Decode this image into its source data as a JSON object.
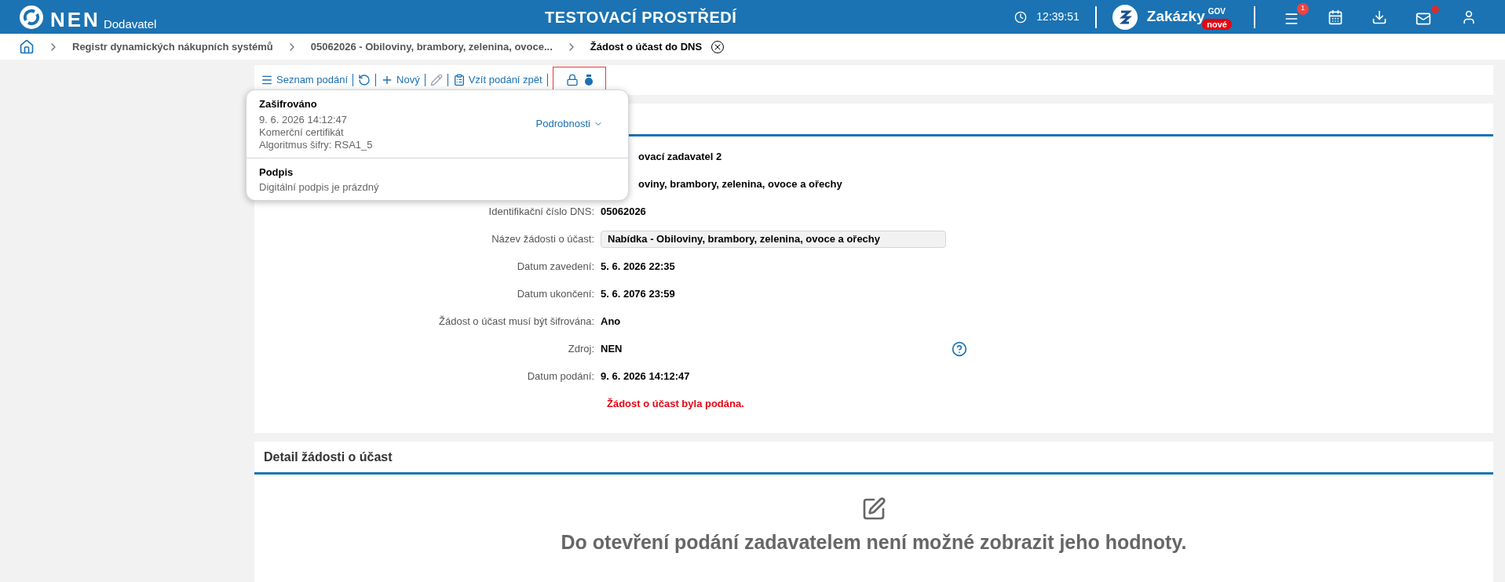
{
  "header": {
    "logo": "NEN",
    "subtitle": "Dodavatel",
    "environment": "TESTOVACÍ PROSTŘEDÍ",
    "time": "12:39:51",
    "brand": {
      "name": "Zakázky",
      "sup": "GOV",
      "badge": "nové"
    },
    "menu_badge": "1",
    "mail_unread": true
  },
  "breadcrumb": [
    {
      "label": "Registr dynamických nákupních systémů",
      "current": false
    },
    {
      "label": "05062026 - Obiloviny, brambory, zelenina, ovoce...",
      "current": false
    },
    {
      "label": "Žádost o účast do DNS",
      "current": true
    }
  ],
  "toolbar": [
    {
      "kind": "list",
      "label": "Seznam podání",
      "disabled": false
    },
    {
      "kind": "refresh",
      "disabled": false
    },
    {
      "kind": "new",
      "label": "Nový",
      "disabled": false
    },
    {
      "kind": "edit",
      "disabled": true
    },
    {
      "kind": "withdraw",
      "label": "Vzít podání zpět",
      "disabled": false
    }
  ],
  "popover": {
    "sections": [
      {
        "title": "Zašifrováno",
        "lines": [
          "9. 6. 2026 14:12:47",
          "Komerční certifikát",
          "Algoritmus šifry: RSA1_5"
        ],
        "link": "Podrobnosti"
      },
      {
        "title": "Podpis",
        "lines": [
          "Digitální podpis je prázdný"
        ]
      }
    ]
  },
  "form": {
    "rows": [
      {
        "kind": "covered",
        "value": "ovací zadavatel 2"
      },
      {
        "kind": "covered",
        "value": "oviny, brambory, zelenina, ovoce a ořechy"
      },
      {
        "kind": "text",
        "label": "Identifikační číslo DNS:",
        "value": "05062026"
      },
      {
        "kind": "field",
        "label": "Název žádosti o účast:",
        "value": "Nabídka - Obiloviny, brambory, zelenina, ovoce a ořechy"
      },
      {
        "kind": "text",
        "label": "Datum zavedení:",
        "value": "5. 6. 2026 22:35"
      },
      {
        "kind": "text",
        "label": "Datum ukončení:",
        "value": "5. 6. 2076 23:59"
      },
      {
        "kind": "text",
        "label": "Žádost o účast musí být šifrována:",
        "value": "Ano"
      },
      {
        "kind": "text",
        "label": "Zdroj:",
        "value": "NEN",
        "help": true
      },
      {
        "kind": "text",
        "label": "Datum podání:",
        "value": "9. 6. 2026 14:12:47"
      }
    ],
    "status": "Žádost o účast byla podána."
  },
  "detail": {
    "title": "Detail žádosti o účast",
    "message": "Do otevření podání zadavatelem není možné zobrazit jeho hodnoty."
  }
}
